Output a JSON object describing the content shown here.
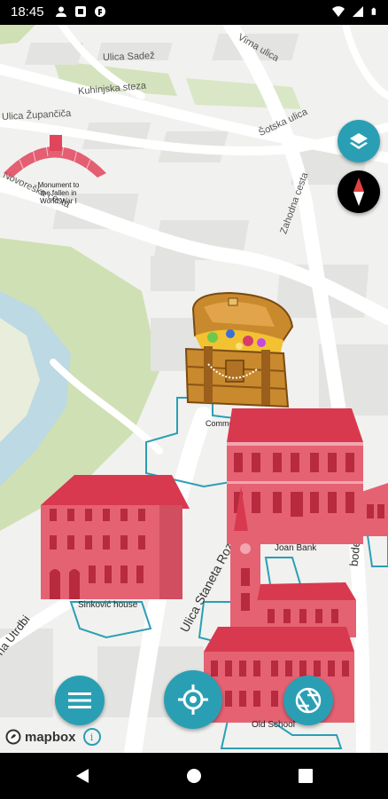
{
  "status_bar": {
    "time": "18:45"
  },
  "map": {
    "streets": {
      "ulica_sadez": "Ulica Sadež",
      "virna_ulica": "Virna ulica",
      "kuhinjska_steza": "Kuhinjska steza",
      "zupanciceva": "Ulica Župančiča",
      "sotska_ulica": "Šotska ulica",
      "novorecka": "Novoreška cesta",
      "zahodna_cesta": "Zahodna cesta",
      "stanetova": "Ulica Staneta Rozmana",
      "utrdbe": "na Utrdbi",
      "bode": "bode"
    },
    "pois": {
      "monument": "Monument to the fallen in World War I",
      "common": "Common the...",
      "joan_bank": "Joan Bank",
      "sinkovic": "Sinković house",
      "old_school": "Old School"
    },
    "attribution": {
      "brand": "mapbox",
      "info_symbol": "i"
    }
  },
  "controls": {
    "layers_icon": "layers-icon",
    "compass_icon": "compass-icon",
    "menu_icon": "menu-icon",
    "locate_icon": "crosshair-icon",
    "camera_icon": "aperture-icon"
  },
  "colors": {
    "accent": "#2a9fb4",
    "building": "#e0455a",
    "park": "#cfe0b4",
    "river": "#bcd9e4"
  }
}
